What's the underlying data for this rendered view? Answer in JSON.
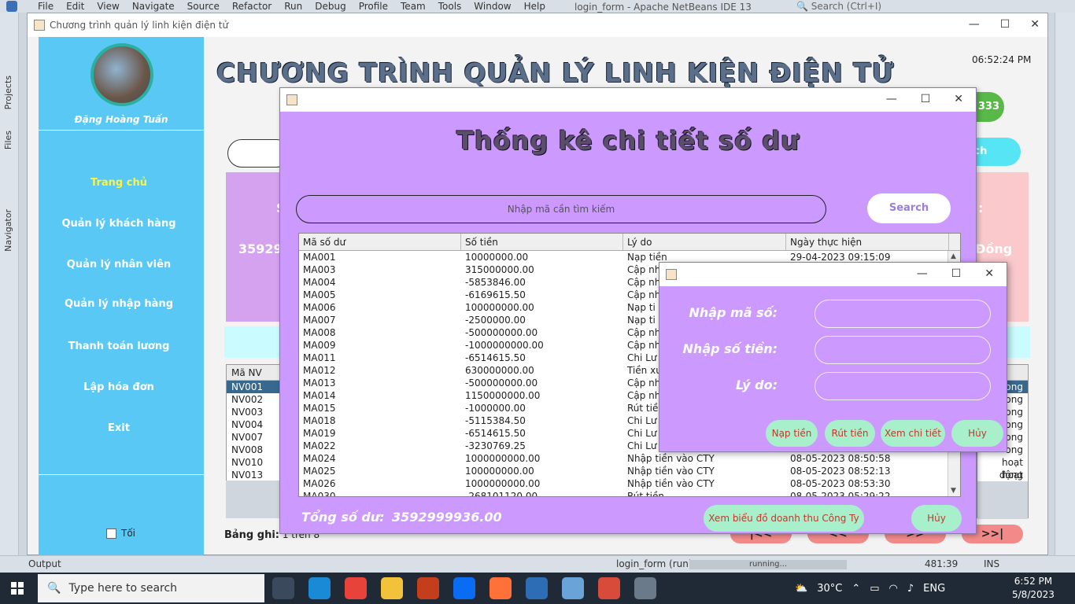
{
  "ide": {
    "menu": [
      "File",
      "Edit",
      "View",
      "Navigate",
      "Source",
      "Refactor",
      "Run",
      "Debug",
      "Profile",
      "Team",
      "Tools",
      "Window",
      "Help"
    ],
    "title": "login_form - Apache NetBeans IDE 13",
    "search_placeholder": "Search (Ctrl+I)",
    "left_tabs": [
      "Projects",
      "Files",
      "Navigator"
    ],
    "bottom_output": "Output",
    "run_label": "login_form (run)",
    "progress_label": "running...",
    "cursor_pos": "481:39",
    "mode": "INS"
  },
  "app": {
    "window_title": "Chương trình quản lý linh kiện điện tử",
    "main_title": "CHƯƠNG TRÌNH QUẢN LÝ LINH KIỆN ĐIỆN TỬ",
    "clock": "06:52:24 PM",
    "badge_partial": "333",
    "search_btn_partial": "rch",
    "user_name": "Đặng Hoàng Tuấn",
    "sidebar": [
      {
        "label": "Trang chủ",
        "active": true
      },
      {
        "label": "Quản lý khách hàng",
        "active": false
      },
      {
        "label": "Quản lý nhân viên",
        "active": false
      },
      {
        "label": "Quản lý nhập hàng",
        "active": false
      },
      {
        "label": "Thanh toán lương",
        "active": false
      },
      {
        "label": "Lập hóa đơn",
        "active": false
      },
      {
        "label": "Exit",
        "active": false
      }
    ],
    "dark_mode_label": "Tối",
    "card_left_s": "S",
    "card_left_value_partial": "359299",
    "card_right_colon": ":",
    "card_right_value_partial": "Đồng",
    "nv_header": "Mã NV",
    "nv_rows": [
      "NV001",
      "NV002",
      "NV003",
      "NV004",
      "NV007",
      "NV008",
      "NV010",
      "NV013"
    ],
    "status_rows": [
      "ong",
      "ong",
      "ong",
      "ong",
      "ong",
      "ong",
      "hoạt động",
      "hoạt động"
    ],
    "record_label": "Bảng ghi:",
    "record_value": "1 trên 8",
    "nav_buttons": [
      "|<<",
      "<<",
      ">>",
      ">>|"
    ]
  },
  "stats_dialog": {
    "heading": "Thống kê chi tiết số dư",
    "search_placeholder": "Nhập mã cần tìm kiếm",
    "search_btn": "Search",
    "columns": [
      "Mã số dư",
      "Số tiền",
      "Lý do",
      "Ngày thực hiện"
    ],
    "rows": [
      [
        "MA001",
        "10000000.00",
        "Nạp tiền",
        "29-04-2023 09:15:09"
      ],
      [
        "MA003",
        "315000000.00",
        "Cập nh",
        ""
      ],
      [
        "MA004",
        "-5853846.00",
        "Cập nh",
        ""
      ],
      [
        "MA005",
        "-6169615.50",
        "Cập nh",
        ""
      ],
      [
        "MA006",
        "100000000.00",
        "Nạp ti",
        ""
      ],
      [
        "MA007",
        "-2500000.00",
        "Nạp ti",
        ""
      ],
      [
        "MA008",
        "-500000000.00",
        "Cập nh",
        ""
      ],
      [
        "MA009",
        "-1000000000.00",
        "Cập nh",
        ""
      ],
      [
        "MA011",
        "-6514615.50",
        "Chi Lư",
        ""
      ],
      [
        "MA012",
        "630000000.00",
        "Tiền xu",
        ""
      ],
      [
        "MA013",
        "-500000000.00",
        "Cập nh",
        ""
      ],
      [
        "MA014",
        "1150000000.00",
        "Cập nh",
        ""
      ],
      [
        "MA015",
        "-1000000.00",
        "Rút tiề",
        ""
      ],
      [
        "MA018",
        "-5115384.50",
        "Chi Lư",
        ""
      ],
      [
        "MA019",
        "-6514615.50",
        "Chi Lư",
        ""
      ],
      [
        "MA022",
        "-3230769.25",
        "Chi Lư",
        ""
      ],
      [
        "MA024",
        "1000000000.00",
        "Nhập tiền vào CTY",
        "08-05-2023 08:50:58"
      ],
      [
        "MA025",
        "100000000.00",
        "Nhập tiền vào CTY",
        "08-05-2023 08:52:13"
      ],
      [
        "MA026",
        "1000000000.00",
        "Nhập tiền vào CTY",
        "08-05-2023 08:53:30"
      ],
      [
        "MA030",
        "-268101120.00",
        "Rút tiền",
        "08-05-2023 05:29:22"
      ]
    ],
    "total_label": "Tổng số dư:",
    "total_value": "3592999936.00",
    "chart_btn": "Xem biểu đồ doanh thu Công Ty",
    "cancel_btn": "Hủy"
  },
  "input_dialog": {
    "labels": [
      "Nhập mã số:",
      "Nhập số tiền:",
      "Lý do:"
    ],
    "buttons": [
      "Nạp tiền",
      "Rút tiền",
      "Xem chi tiết",
      "Hủy"
    ]
  },
  "taskbar": {
    "search_placeholder": "Type here to search",
    "temperature": "30°C",
    "language": "ENG",
    "time": "6:52 PM",
    "date": "5/8/2023"
  },
  "colors": {
    "sidebar": "#5ac8f5",
    "dialog_bg": "#cc99ff",
    "action_btn": "#a8f0cc",
    "active_item": "#f7f54a"
  }
}
